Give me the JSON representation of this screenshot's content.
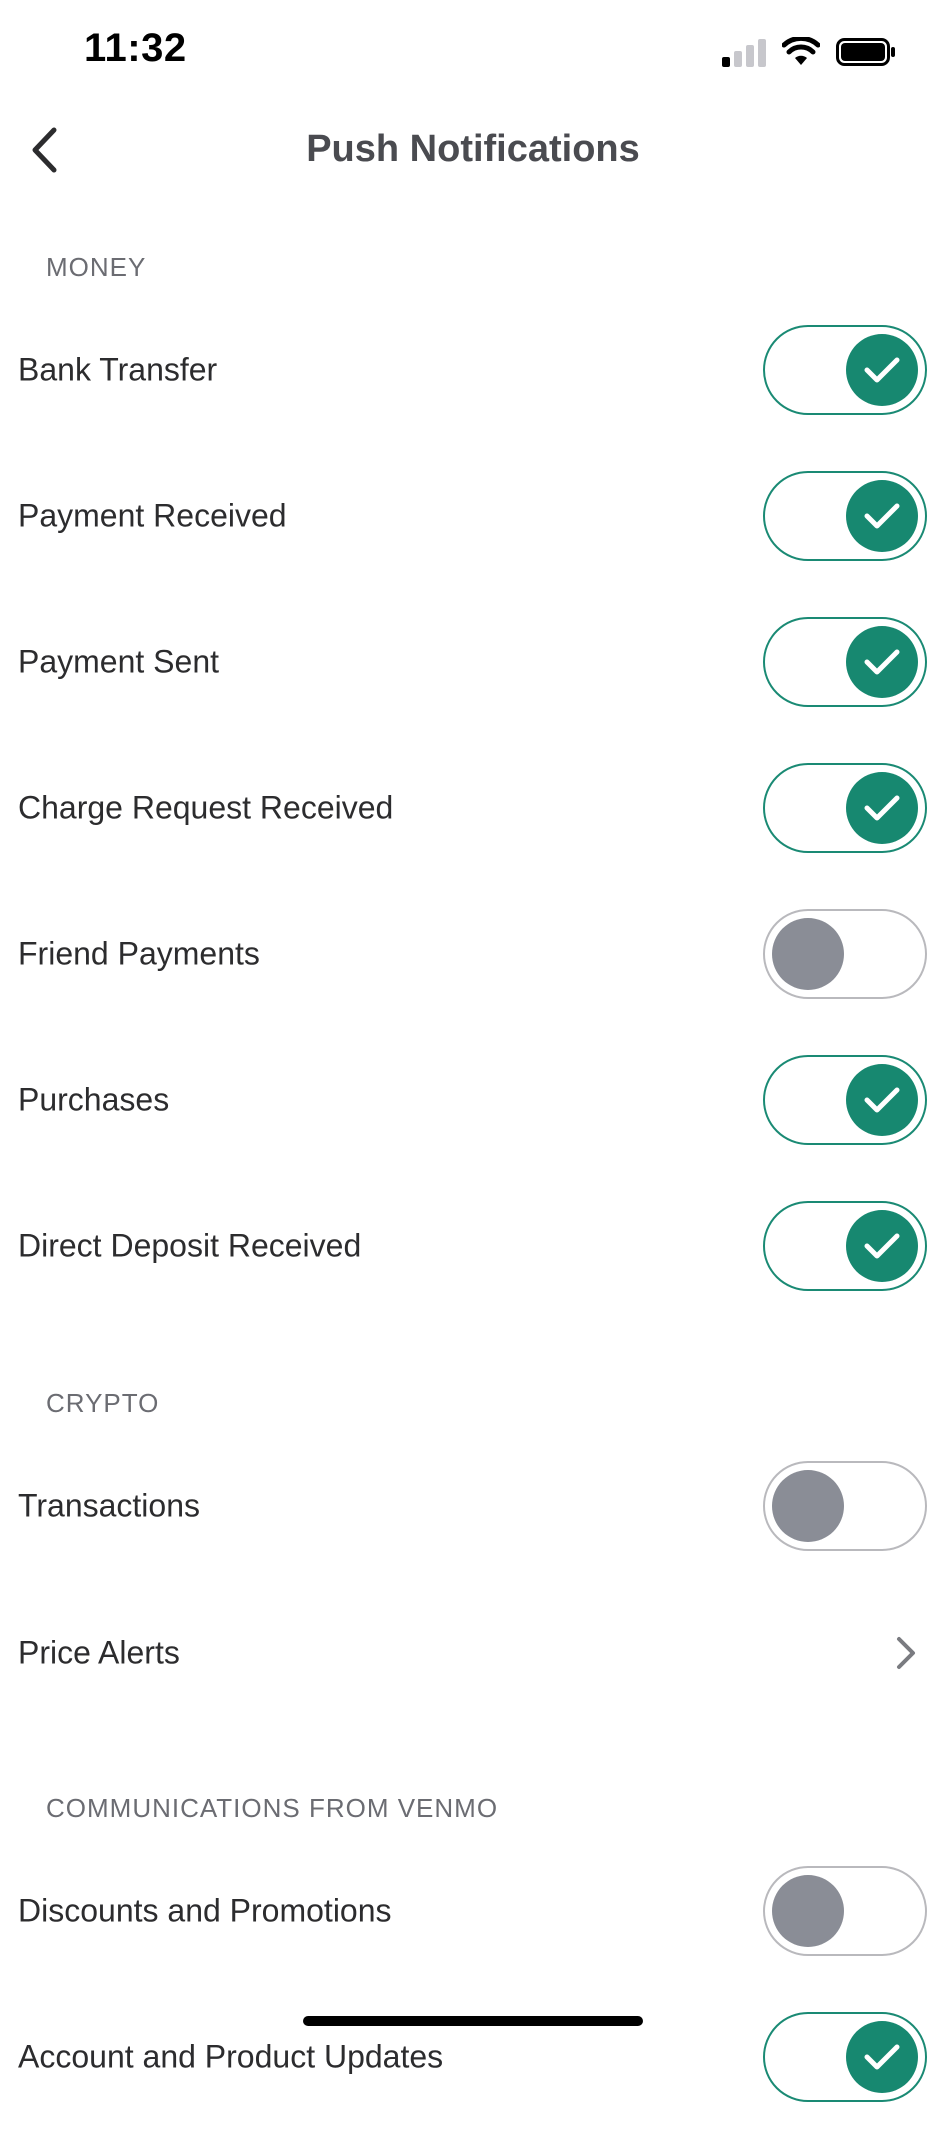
{
  "status_bar": {
    "time": "11:32",
    "icons": [
      "cellular-signal-icon",
      "wifi-icon",
      "battery-icon"
    ]
  },
  "nav": {
    "title": "Push Notifications",
    "back_icon": "chevron-left-icon"
  },
  "colors": {
    "toggle_on": "#178870",
    "toggle_off_knob": "#8a8d96",
    "header_text": "#6b6c72"
  },
  "sections": {
    "money": {
      "header": "MONEY",
      "items": [
        {
          "label": "Bank Transfer",
          "enabled": true
        },
        {
          "label": "Payment Received",
          "enabled": true
        },
        {
          "label": "Payment Sent",
          "enabled": true
        },
        {
          "label": "Charge Request Received",
          "enabled": true
        },
        {
          "label": "Friend Payments",
          "enabled": false
        },
        {
          "label": "Purchases",
          "enabled": true
        },
        {
          "label": "Direct Deposit Received",
          "enabled": true
        }
      ]
    },
    "crypto": {
      "header": "CRYPTO",
      "items": [
        {
          "label": "Transactions",
          "enabled": false
        },
        {
          "label": "Price Alerts",
          "type": "link"
        }
      ]
    },
    "communications": {
      "header": "COMMUNICATIONS FROM VENMO",
      "items": [
        {
          "label": "Discounts and Promotions",
          "enabled": false
        },
        {
          "label": "Account and Product Updates",
          "enabled": true
        }
      ]
    }
  }
}
